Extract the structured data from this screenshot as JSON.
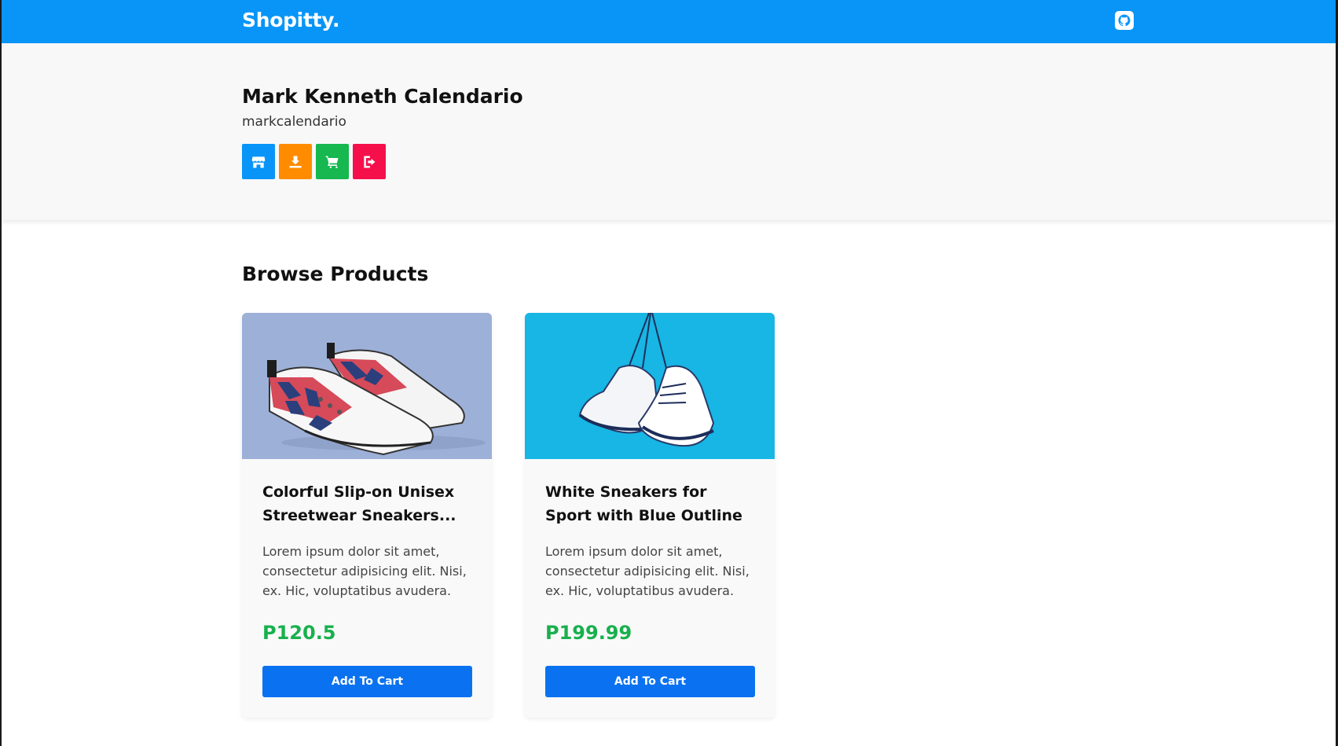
{
  "app": {
    "brand": "Shopitty.",
    "accent_color": "#0895f7",
    "github_icon": "github-icon"
  },
  "profile": {
    "name": "Mark Kenneth Calendario",
    "username": "markcalendario",
    "actions": [
      {
        "icon": "store-icon",
        "color": "#0895f7"
      },
      {
        "icon": "seller-icon",
        "color": "#ff8c00"
      },
      {
        "icon": "cart-icon",
        "color": "#16b84f"
      },
      {
        "icon": "logout-icon",
        "color": "#f5104b"
      }
    ]
  },
  "main": {
    "section_title": "Browse Products",
    "products": [
      {
        "title": "Colorful Slip-on Unisex Streetwear Sneakers...",
        "description": "Lorem ipsum dolor sit amet, consectetur adipisicing elit. Nisi, ex. Hic, voluptatibus avudera.",
        "price": "P120.5",
        "button_label": "Add To Cart"
      },
      {
        "title": "White Sneakers for Sport with Blue Outline",
        "description": "Lorem ipsum dolor sit amet, consectetur adipisicing elit. Nisi, ex. Hic, voluptatibus avudera.",
        "price": "P199.99",
        "button_label": "Add To Cart"
      }
    ]
  }
}
